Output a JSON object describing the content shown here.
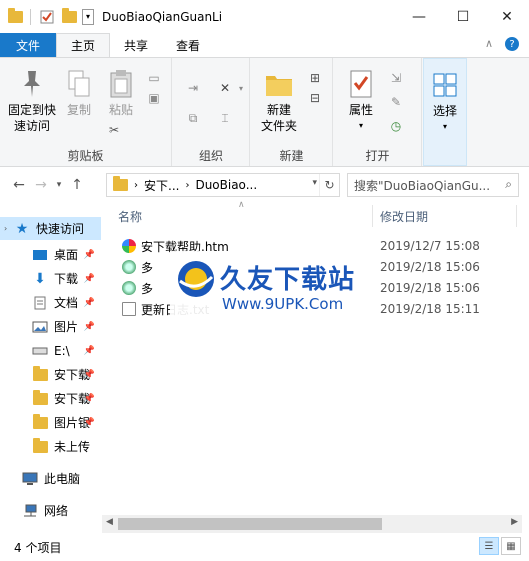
{
  "window": {
    "title": "DuoBiaoQianGuanLi",
    "minimize": "—",
    "maximize": "☐",
    "close": "✕"
  },
  "ribbon_tabs": [
    {
      "label": "文件"
    },
    {
      "label": "主页"
    },
    {
      "label": "共享"
    },
    {
      "label": "查看"
    }
  ],
  "ribbon": {
    "clipboard": {
      "label": "剪贴板",
      "pin": "固定到快\n速访问",
      "copy": "复制",
      "paste": "粘贴"
    },
    "organize": {
      "label": "组织"
    },
    "new": {
      "label": "新建",
      "new_folder": "新建\n文件夹"
    },
    "open": {
      "label": "打开",
      "properties": "属性"
    },
    "select": {
      "label": "选择",
      "select": "选择"
    }
  },
  "address": {
    "crumb1": "安下...",
    "crumb2": "DuoBiao...",
    "search_placeholder": "搜索\"DuoBiaoQianGu..."
  },
  "sidebar": {
    "items": [
      {
        "label": "快速访问"
      },
      {
        "label": "桌面"
      },
      {
        "label": "下载"
      },
      {
        "label": "文档"
      },
      {
        "label": "图片"
      },
      {
        "label": "E:\\"
      },
      {
        "label": "安下载"
      },
      {
        "label": "安下载"
      },
      {
        "label": "图片银"
      },
      {
        "label": "未上传"
      },
      {
        "label": "此电脑"
      },
      {
        "label": "网络"
      }
    ]
  },
  "columns": {
    "name": "名称",
    "date": "修改日期"
  },
  "files": [
    {
      "name": "安下载帮助.htm",
      "date": "2019/12/7 15:08",
      "extra": ""
    },
    {
      "name": "多",
      "date": "2019/2/18 15:06",
      "extra": ""
    },
    {
      "name": "多",
      "date": "2019/2/18 15:06",
      "extra": ""
    },
    {
      "name": "更新日志.txt",
      "date": "2019/2/18 15:11",
      "extra": ""
    }
  ],
  "watermark": {
    "brand": "久友下载站",
    "url": "Www.9UPK.Com"
  },
  "status": {
    "count": "4 个项目"
  },
  "colors": {
    "accent": "#1979ca",
    "selected": "#cce8ff",
    "folder": "#e8b83b"
  }
}
